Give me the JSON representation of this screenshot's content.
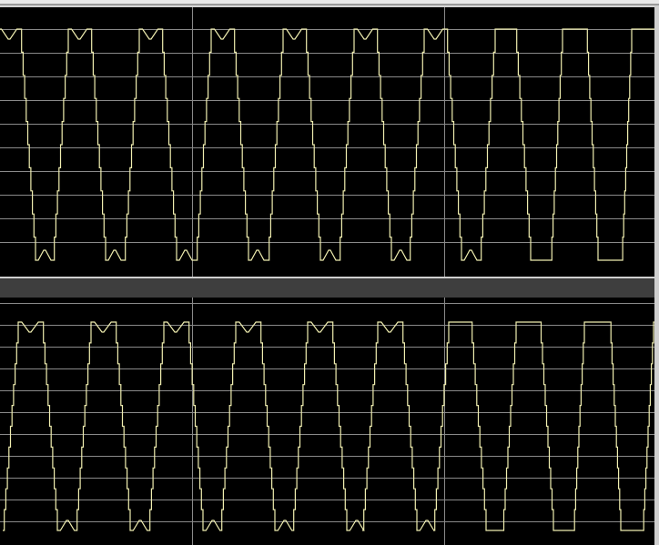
{
  "colors": {
    "background": "#000000",
    "grid": "#8a8a8a",
    "trace": "#f0eeb0"
  },
  "traces": [
    {
      "id": "trace-top",
      "cycles": [
        {
          "center": 10,
          "period": 78,
          "wt": 24,
          "wb": 20,
          "dip": true
        },
        {
          "center": 87,
          "period": 78,
          "wt": 24,
          "wb": 20,
          "dip": true
        },
        {
          "center": 165,
          "period": 78,
          "wt": 24,
          "wb": 20,
          "dip": true
        },
        {
          "center": 244,
          "period": 78,
          "wt": 24,
          "wb": 20,
          "dip": true
        },
        {
          "center": 323,
          "period": 78,
          "wt": 24,
          "wb": 20,
          "dip": true
        },
        {
          "center": 401,
          "period": 78,
          "wt": 24,
          "wb": 20,
          "dip": true
        },
        {
          "center": 478,
          "period": 78,
          "wt": 24,
          "wb": 20,
          "dip": true
        },
        {
          "center": 555,
          "period": 78,
          "wt": 22,
          "wb": 22,
          "dip": false
        },
        {
          "center": 631,
          "period": 78,
          "wt": 26,
          "wb": 26,
          "dip": false
        },
        {
          "center": 708,
          "period": 78,
          "wt": 28,
          "wb": 28,
          "dip": false
        }
      ]
    },
    {
      "id": "trace-bottom",
      "cycles": [
        {
          "center": 33,
          "period": 82,
          "wt": 26,
          "wb": 22,
          "dip": true
        },
        {
          "center": 113,
          "period": 82,
          "wt": 26,
          "wb": 22,
          "dip": true
        },
        {
          "center": 193,
          "period": 82,
          "wt": 26,
          "wb": 22,
          "dip": true
        },
        {
          "center": 272,
          "period": 82,
          "wt": 26,
          "wb": 22,
          "dip": true
        },
        {
          "center": 351,
          "period": 82,
          "wt": 26,
          "wb": 22,
          "dip": true
        },
        {
          "center": 428,
          "period": 82,
          "wt": 26,
          "wb": 22,
          "dip": true
        },
        {
          "center": 505,
          "period": 82,
          "wt": 24,
          "wb": 24,
          "dip": false
        },
        {
          "center": 580,
          "period": 82,
          "wt": 26,
          "wb": 26,
          "dip": false
        },
        {
          "center": 656,
          "period": 82,
          "wt": 28,
          "wb": 30,
          "dip": false
        },
        {
          "center": 732,
          "period": 82,
          "wt": 28,
          "wb": 30,
          "dip": false
        }
      ]
    }
  ]
}
